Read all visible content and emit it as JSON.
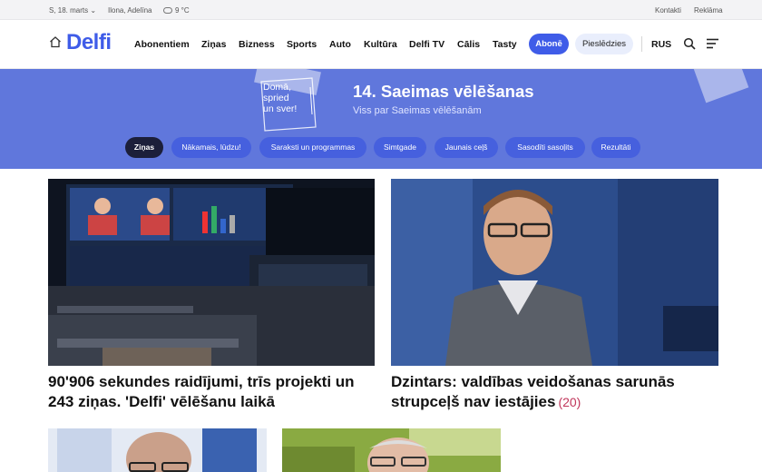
{
  "topbar": {
    "date": "S, 18. marts",
    "name_day": "Ilona, Adelīna",
    "temperature": "9 °C",
    "weather_icon": "cloud-icon",
    "links": [
      "Kontakti",
      "Reklāma"
    ]
  },
  "nav": {
    "logo": "Delfi",
    "items": [
      "Abonentiem",
      "Ziņas",
      "Bizness",
      "Sports",
      "Auto",
      "Kultūra",
      "Delfi TV",
      "Cālis",
      "Tasty"
    ],
    "subscribe": "Abonē",
    "login": "Pieslēdzies",
    "language": "RUS",
    "brand_color": "#3f5ce8"
  },
  "banner": {
    "ballot_text": "Domā,\nspried\nun sver!",
    "title": "14. Saeimas vēlēšanas",
    "subtitle": "Viss par Saeimas vēlēšanām",
    "background_color": "#6077dc",
    "tabs": [
      "Ziņas",
      "Nākamais, lūdzu!",
      "Saraksti un programmas",
      "Simtgade",
      "Jaunais ceļš",
      "Sasodīti sasoļits",
      "Rezultāti"
    ],
    "active_tab": "Ziņas"
  },
  "articles": [
    {
      "headline": "90'906 sekundes raidījumi, trīs projekti un 243 ziņas. 'Delfi' vēlēšanu laikā",
      "comments": ""
    },
    {
      "headline": "Dzintars: valdības veidošanas sarunās strupceļš nav iestājies",
      "comments": "(20)"
    },
    {
      "headline": "",
      "comments": ""
    },
    {
      "headline": "",
      "comments": ""
    }
  ]
}
